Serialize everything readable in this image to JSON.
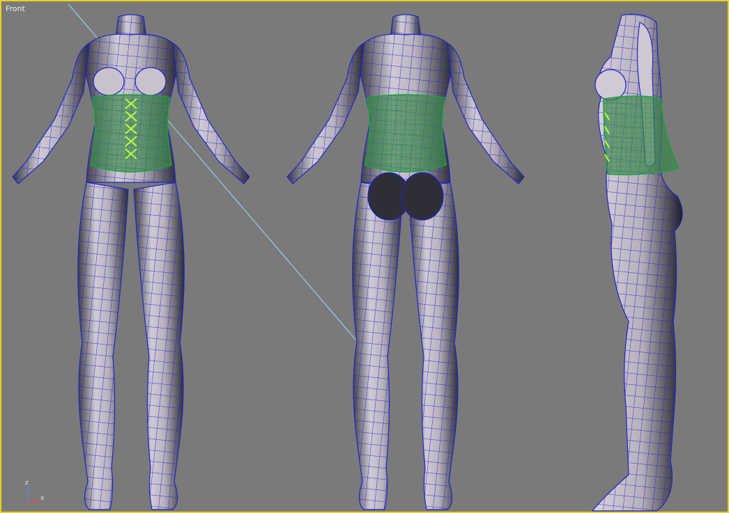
{
  "viewport": {
    "label": "Front",
    "border_color": "#e6d21a",
    "background_color": "#7a7a7a"
  },
  "models": [
    {
      "name": "female-figure-front",
      "view": "front",
      "has_corset_lacing": true
    },
    {
      "name": "female-figure-back",
      "view": "back",
      "has_corset_lacing": false
    },
    {
      "name": "female-figure-side",
      "view": "side",
      "has_corset_lacing": true
    }
  ],
  "colors": {
    "body_wire": "#2323c8",
    "corset_wire": "#1ea03c",
    "lacing": "#b9ff3c",
    "selection_line": "#9fd8ff",
    "selection_box": "#e6d21a"
  },
  "axis_gizmo": {
    "z_label": "z",
    "x_label": "x"
  }
}
